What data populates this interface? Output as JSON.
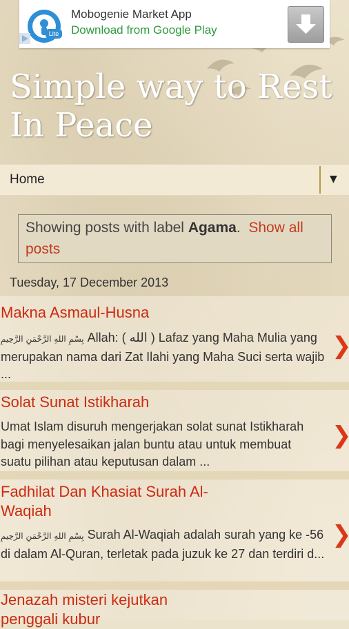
{
  "ad": {
    "title": "Mobogenie Market App",
    "subtitle": "Download from Google Play",
    "logo_icon": "mobogenie-lite-logo",
    "badge": "Lite"
  },
  "blog": {
    "title": "Simple way to Rest In Peace"
  },
  "nav": {
    "home": "Home",
    "menu_arrow": "▼"
  },
  "status": {
    "prefix": "Showing posts with label",
    "label": "Agama",
    "suffix": ".",
    "link": "Show all posts"
  },
  "date": "Tuesday, 17 December 2013",
  "posts": [
    {
      "title": "Makna Asmaul-Husna",
      "arabic": "بِسْمِ اللهِ الرَّحْمَنِ الرَّحِيمِ",
      "snippet": "Allah: ( الله ) Lafaz yang Maha Mulia yang merupakan nama dari Zat Ilahi yang Maha Suci serta wajib ..."
    },
    {
      "title": "Solat Sunat Istikharah",
      "arabic": "",
      "snippet": "Umat Islam disuruh mengerjakan solat sunat Istikharah bagi menyelesaikan jalan buntu atau untuk membuat suatu pilihan atau keputusan dalam ..."
    },
    {
      "title": "Fadhilat Dan Khasiat Surah Al-Waqiah",
      "arabic": "بِسْمِ اللهِ الرَّحْمَنِ الرَّحِيمِ",
      "snippet": "Surah Al-Waqiah adalah surah yang ke -56 di dalam Al-Quran, terletak pada juzuk ke 27 dan terdiri d..."
    },
    {
      "title": "Jenazah misteri kejutkan penggali kubur",
      "arabic": "",
      "snippet": ""
    }
  ],
  "chevron": "❯",
  "colors": {
    "accent": "#cc2a12",
    "ad_green": "#2e9b3e",
    "background": "#ece3cc"
  }
}
